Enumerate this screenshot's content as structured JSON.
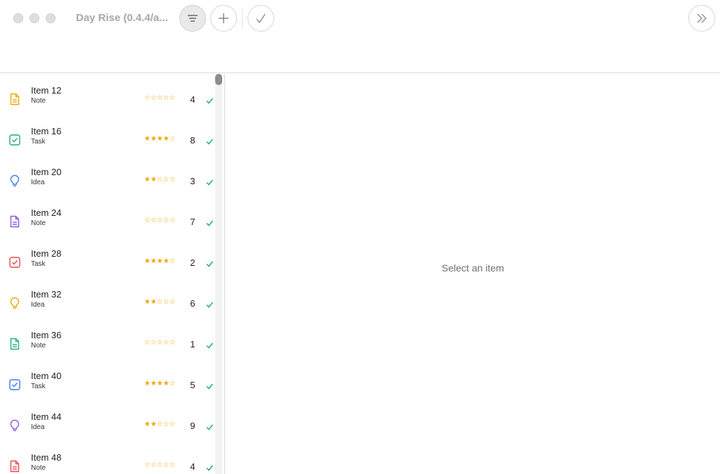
{
  "window": {
    "title": "Day Rise (0.4.4/a..."
  },
  "toolbar": {
    "filter_icon": "filter-lines-icon",
    "add_icon": "plus-icon",
    "complete_icon": "checkmark-icon",
    "collapse_icon": "double-chevron-right-icon"
  },
  "colors": {
    "star": "#f0a500",
    "check": "#1fae7a",
    "orange": "#f0a500",
    "green": "#1fae7a",
    "blue": "#3b7be8",
    "purple": "#8a55e0",
    "red": "#e5484d"
  },
  "items": [
    {
      "name": "Item 12",
      "type": "Note",
      "icon": "document-icon",
      "color": "orange",
      "rating": 0,
      "count": "4"
    },
    {
      "name": "Item 16",
      "type": "Task",
      "icon": "checkbox-icon",
      "color": "green",
      "rating": 4,
      "count": "8"
    },
    {
      "name": "Item 20",
      "type": "Idea",
      "icon": "lightbulb-icon",
      "color": "blue",
      "rating": 2,
      "count": "3"
    },
    {
      "name": "Item 24",
      "type": "Note",
      "icon": "document-icon",
      "color": "purple",
      "rating": 0,
      "count": "7"
    },
    {
      "name": "Item 28",
      "type": "Task",
      "icon": "checkbox-icon",
      "color": "red",
      "rating": 4,
      "count": "2"
    },
    {
      "name": "Item 32",
      "type": "Idea",
      "icon": "lightbulb-icon",
      "color": "orange",
      "rating": 2,
      "count": "6"
    },
    {
      "name": "Item 36",
      "type": "Note",
      "icon": "document-icon",
      "color": "green",
      "rating": 0,
      "count": "1"
    },
    {
      "name": "Item 40",
      "type": "Task",
      "icon": "checkbox-icon",
      "color": "blue",
      "rating": 4,
      "count": "5"
    },
    {
      "name": "Item 44",
      "type": "Idea",
      "icon": "lightbulb-icon",
      "color": "purple",
      "rating": 2,
      "count": "9"
    },
    {
      "name": "Item 48",
      "type": "Note",
      "icon": "document-icon",
      "color": "red",
      "rating": 0,
      "count": "4"
    }
  ],
  "detail": {
    "empty_message": "Select an item"
  }
}
